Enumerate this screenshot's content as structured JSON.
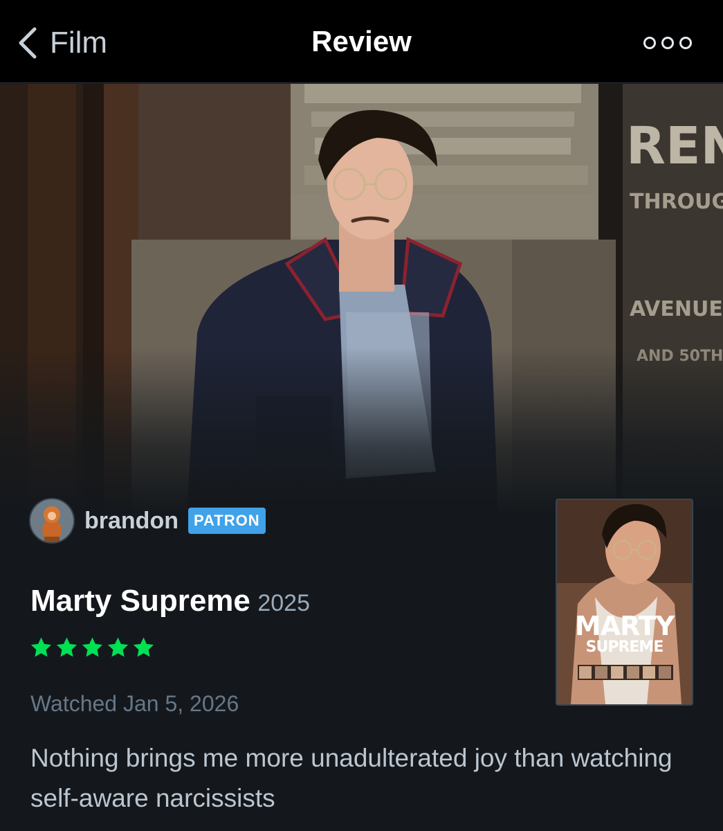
{
  "nav": {
    "back_label": "Film",
    "title": "Review"
  },
  "reviewer": {
    "username": "brandon",
    "badge": "PATRON"
  },
  "film": {
    "title": "Marty Supreme",
    "year": "2025",
    "rating": 5,
    "rating_max": 5,
    "rating_color": "#00e054"
  },
  "watched": "Watched Jan 5, 2026",
  "review": "Nothing brings me more unadulterated joy than watching self-aware narcissists",
  "poster": {
    "line1": "MARTY",
    "line2": "SUPREME"
  },
  "colors": {
    "background": "#14181c",
    "navbar": "#000000",
    "badge": "#40a2e8",
    "star": "#00e054"
  }
}
